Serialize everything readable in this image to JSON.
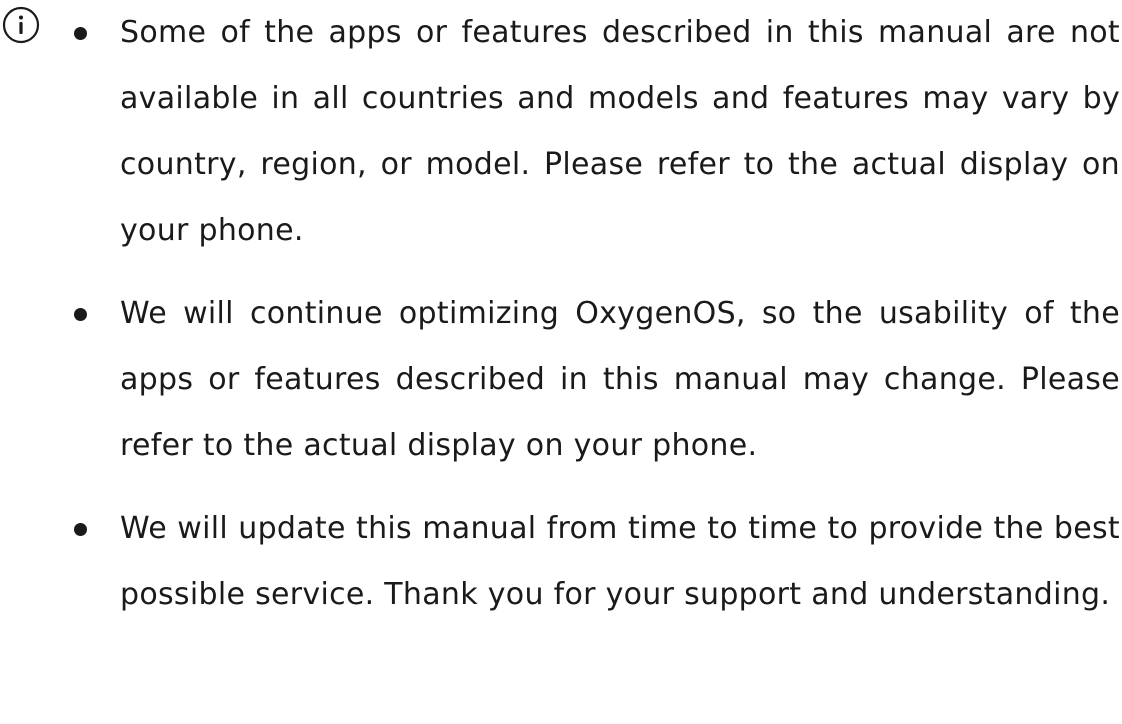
{
  "icon": "info-icon",
  "notes": [
    "Some of the apps or features described in this manual are not available in all countries and models and features may vary by country, region, or model. Please refer to the actual display on your phone.",
    "We will continue optimizing OxygenOS, so the usability of the apps or features described in this manual may change. Please refer to the actual display on your phone.",
    "We will update this manual from time to time to provide the best possible service. Thank you for your support and understanding."
  ]
}
